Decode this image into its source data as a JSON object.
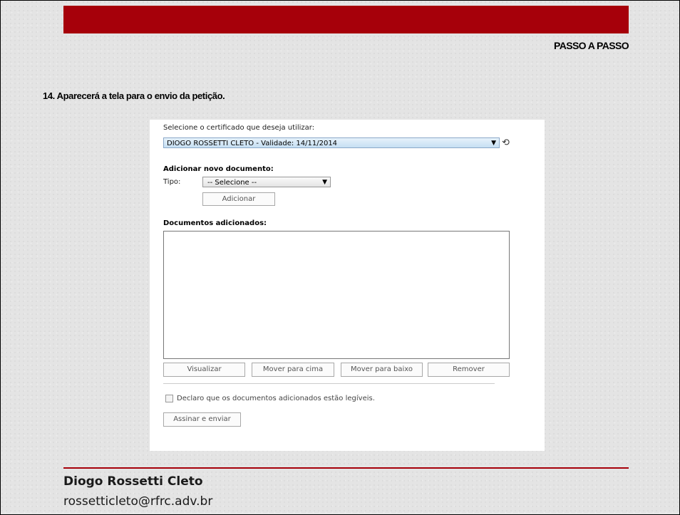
{
  "header": {
    "section_title": "PASSO A PASSO"
  },
  "step": {
    "text": "14. Aparecerá a tela para o envio da petição."
  },
  "form": {
    "cert_label": "Selecione o certificado que deseja utilizar:",
    "cert_value": "DIOGO ROSSETTI CLETO - Validade: 14/11/2014",
    "add_doc_title": "Adicionar novo documento:",
    "tipo_label": "Tipo:",
    "tipo_value": "-- Selecione --",
    "adicionar_label": "Adicionar",
    "docs_title": "Documentos adicionados:",
    "visualizar_label": "Visualizar",
    "mover_cima_label": "Mover para cima",
    "mover_baixo_label": "Mover para baixo",
    "remover_label": "Remover",
    "declaro_label": "Declaro que os documentos adicionados estão legíveis.",
    "assinar_label": "Assinar e enviar"
  },
  "footer": {
    "author": "Diogo Rossetti Cleto",
    "email": "rossetticleto@rfrc.adv.br"
  },
  "colors": {
    "accent": "#a6000a"
  }
}
